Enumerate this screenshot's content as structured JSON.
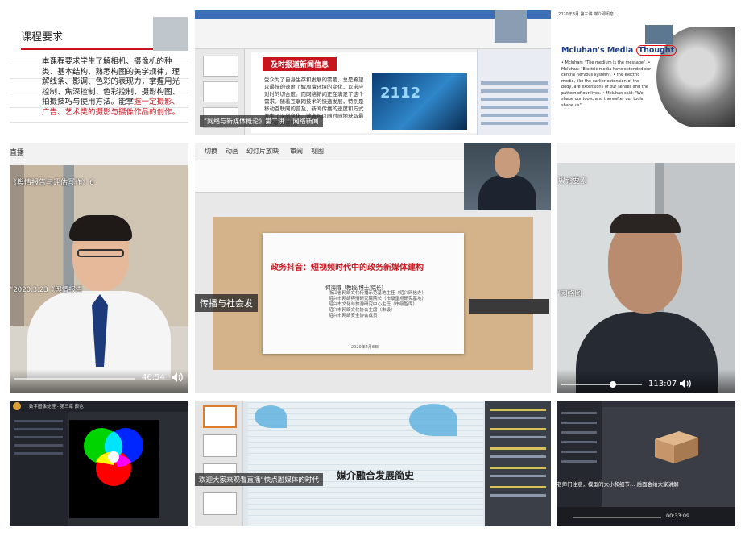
{
  "tiles": {
    "course": {
      "slide_title": "课程要求",
      "body_text": "本课程要求学生了解相机、摄像机的种类、基本结构、熟悉构图的美学规律，理解线条、影调、色彩的表现力，掌握用光控制、焦深控制、色彩控制、摄影构图、拍摄技巧与使用方法。能掌",
      "body_highlight": "握一定摄影、广告、艺术类的摄影与摄像作品的创作。"
    },
    "news": {
      "slide_title": "及时报道新闻信息",
      "slide_body": "受众为了自身生存和发展的需要，总是希望以最快的速度了解周遭环境的变化，以求应对时的切合度。而网络新闻正在满足了这个需求。随着互联网技术的快速发展，特别是移动互联网的普及，新闻传播的速度和方式发生了深刻变化，读者可以随时随地获取最新的新闻资讯。",
      "digits": "2112",
      "caption": "“网络与新媒体概论》第二讲 ：网络新闻"
    },
    "mcluhan": {
      "header": "2020年3月 第三讲 媒介即讯息",
      "title_a": "Mcluhan's Media ",
      "title_b": "Thought",
      "text": "• Mcluhan: \"The medium is the message\". • Mcluhan: \"Electric media have extended our central nervous system\". • the electric media, like the earlier extension of the body, are extensions of our senses and the pattern of our lives. • Mcluhan said: \"We shape our tools, and thereafter our tools shape us\"."
    },
    "teacher": {
      "live_label": "直播",
      "subtitle1": "《舆情报告与评估写作》6",
      "subtitle2": "“2020.3.23《舆情报告",
      "time": "46:54"
    },
    "main_slide": {
      "menu": [
        "切换",
        "动画",
        "幻灯片放映",
        "审阅",
        "视图"
      ],
      "title": "政务抖音：短视频时代中的政务新媒体建构",
      "name": "何海翔（教授/博士/院长）",
      "lines": [
        "浙江省网络文化传播示范基地主任（绍兴网信办）",
        "绍兴市网络舆情研究院院长（市级重点研究基地）",
        "绍兴市文化与旅游研究中心主任（市级智库）",
        "绍兴市网络文化协会主席（市级）",
        "绍兴市网络安全协会成员"
      ],
      "date": "2020年4月8日",
      "caption": "传播与社会发"
    },
    "face": {
      "label1": "舆论要素",
      "label2": "“网络图",
      "time": "113:07"
    },
    "rgb": {
      "title": "数字图像处理 - 第三章 颜色"
    },
    "media": {
      "title": "媒介融合发展简史",
      "caption": "欢迎大家来观看直播“快点融媒体的时代"
    },
    "threed": {
      "caption": "老师们注意，模型的大小和细节…  后面会给大家讲解",
      "time": "00:33:09"
    }
  },
  "colors": {
    "accent_red": "#c8141e",
    "ppt_blue": "#3b6fb6"
  }
}
